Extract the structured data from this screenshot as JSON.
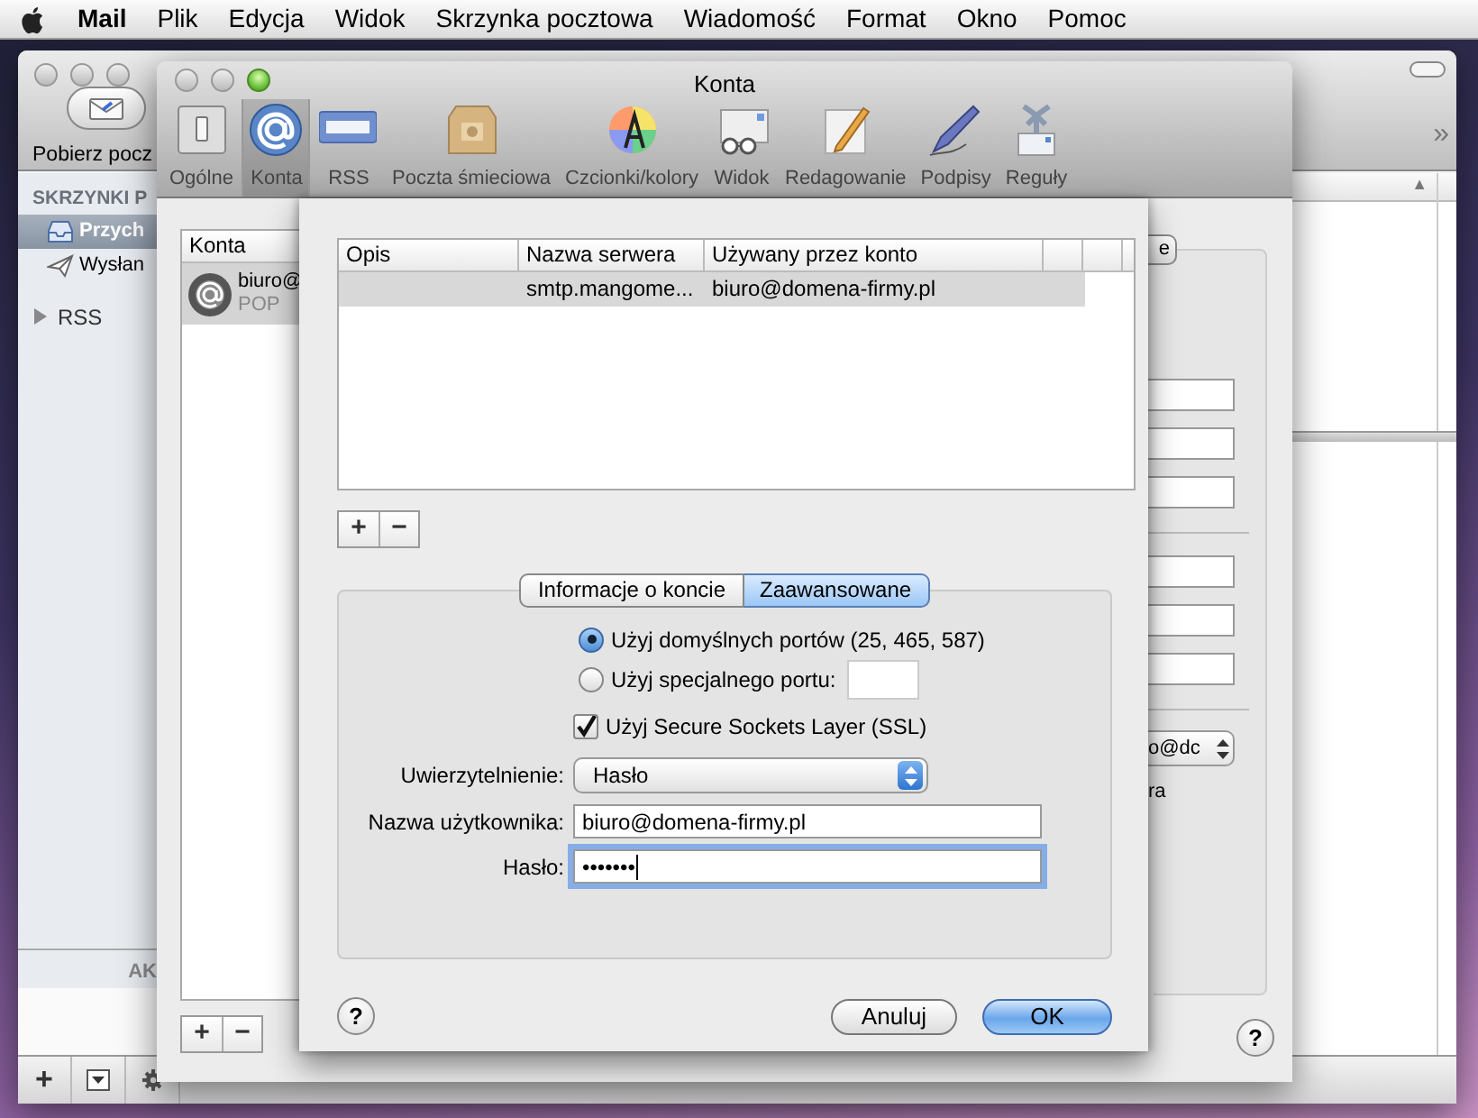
{
  "menu_bar": {
    "app": "Mail",
    "menus": [
      "Plik",
      "Edycja",
      "Widok",
      "Skrzynka pocztowa",
      "Wiadomość",
      "Format",
      "Okno",
      "Pomoc"
    ]
  },
  "mail_window": {
    "toolbar_button": "Pobierz pocz",
    "overflow": "»",
    "sort_indicator": "▲",
    "sidebar": {
      "heading": "SKRZYNKI P",
      "items": [
        {
          "label": "Przych",
          "selected": true
        },
        {
          "label": "Wysłan",
          "selected": false
        }
      ],
      "groups": [
        {
          "label": "RSS",
          "expanded": false
        }
      ]
    },
    "activity_heading": "AK",
    "footer_button": "+"
  },
  "preferences": {
    "title": "Konta",
    "toolbar": [
      {
        "label": "Ogólne",
        "selected": false
      },
      {
        "label": "Konta",
        "selected": true
      },
      {
        "label": "RSS",
        "selected": false
      },
      {
        "label": "Poczta śmieciowa",
        "selected": false
      },
      {
        "label": "Czcionki/kolory",
        "selected": false
      },
      {
        "label": "Widok",
        "selected": false
      },
      {
        "label": "Redagowanie",
        "selected": false
      },
      {
        "label": "Podpisy",
        "selected": false
      },
      {
        "label": "Reguły",
        "selected": false
      }
    ],
    "accounts": {
      "heading": "Konta",
      "items": [
        {
          "name": "biuro@",
          "type": "POP",
          "selected": true
        }
      ],
      "buttons": [
        "+",
        "−"
      ]
    },
    "partly_hidden": {
      "button": "e",
      "popup_value": "o@dc",
      "text": "ra"
    },
    "help": "?"
  },
  "sheet": {
    "table": {
      "columns": [
        "Opis",
        "Nazwa serwera",
        "Używany przez konto"
      ],
      "rows": [
        {
          "server": "smtp.mangome...",
          "account": "biuro@domena-firmy.pl",
          "selected": true
        }
      ]
    },
    "table_buttons": [
      "+",
      "−"
    ],
    "tabs": [
      {
        "label": "Informacje o koncie",
        "selected": false
      },
      {
        "label": "Zaawansowane",
        "selected": true
      }
    ],
    "port_options": [
      {
        "label": "Użyj domyślnych portów (25, 465, 587)",
        "selected": true,
        "kind": "plain"
      },
      {
        "label": "Użyj specjalnego portu:",
        "selected": false,
        "kind": "with_field"
      }
    ],
    "ssl": {
      "label": "Użyj Secure Sockets Layer (SSL)",
      "checked": true
    },
    "fields": [
      {
        "label": "Uwierzytelnienie:",
        "kind": "popup",
        "value": "Hasło"
      },
      {
        "label": "Nazwa użytkownika:",
        "kind": "text",
        "value": "biuro@domena-firmy.pl"
      },
      {
        "label": "Hasło:",
        "kind": "password",
        "value": "•••••••",
        "focused": true
      }
    ],
    "help": "?",
    "buttons": [
      {
        "label": "Anuluj",
        "kind": "cancel"
      },
      {
        "label": "OK",
        "kind": "default"
      }
    ]
  }
}
